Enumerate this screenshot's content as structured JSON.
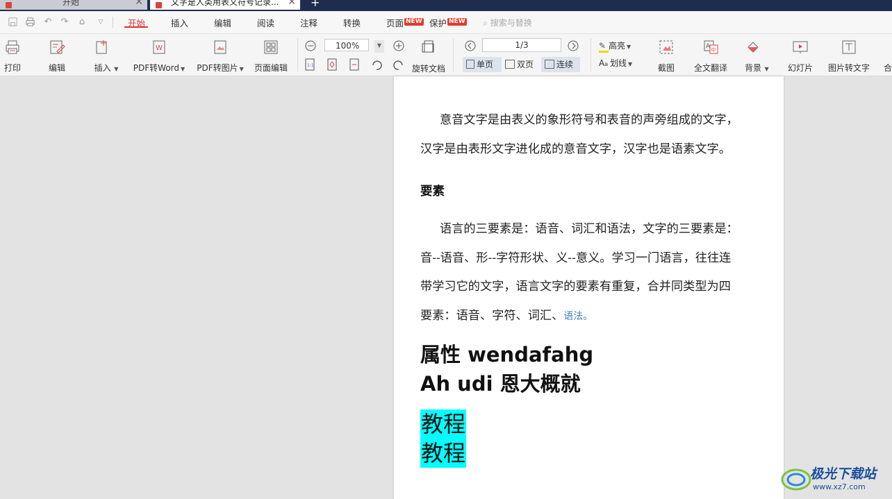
{
  "tabs": {
    "home_label": "开始",
    "doc_label": "文字是人类用表义符号记录...",
    "close_glyph": "✕",
    "new_tab_glyph": "+"
  },
  "menu": {
    "items": [
      "开始",
      "插入",
      "编辑",
      "阅读",
      "注释",
      "转换",
      "页面",
      "保护"
    ],
    "active": "开始",
    "new_badge": "NEW",
    "search_placeholder": "搜索与替换"
  },
  "ribbon": {
    "print": "打印",
    "edit": "编辑",
    "insert": "插入",
    "pdf_to_word": "PDF转Word",
    "pdf_to_image": "PDF转图片",
    "page_edit": "页面编辑",
    "zoom_value": "100%",
    "rotate_doc": "旋转文档",
    "page_value": "1/3",
    "single_page": "单页",
    "double_page": "双页",
    "continuous": "连续",
    "highlight": "高亮",
    "strikethrough": "划线",
    "screenshot": "截图",
    "full_translate": "全文翻译",
    "background": "背景",
    "slideshow": "幻灯片",
    "image_to_text": "图片转文字",
    "more_partial": "合"
  },
  "document": {
    "para1_line1": "意音文字是由表义的象形符号和表音的声旁组成的文字，",
    "para1_line2": "汉字是由表形文字进化成的意音文字，汉字也是语素文字。",
    "heading": "要素",
    "para2_line1": "语言的三要素是：语音、词汇和语法，文字的三要素是：",
    "para2_line2": "音--语音、形--字符形状、义--意义。学习一门语言，往往连",
    "para2_line3": "带学习它的文字，语言文字的要素有重复，合并同类型为四",
    "para2_line4": "要素：语音、字符、词汇、",
    "para2_link": "语法。",
    "big_line1": "属性 wendafahg",
    "big_line2": "Ah udi 恩大概就",
    "highlight_line1": "教程",
    "highlight_line2": "教程"
  },
  "watermark": {
    "text": "极光下载站",
    "url": "www.xz7.com"
  },
  "colors": {
    "accent": "#dd3333",
    "highlight": "#00ffff",
    "titlebar": "#1f2d4d",
    "link": "#3a80c9"
  }
}
